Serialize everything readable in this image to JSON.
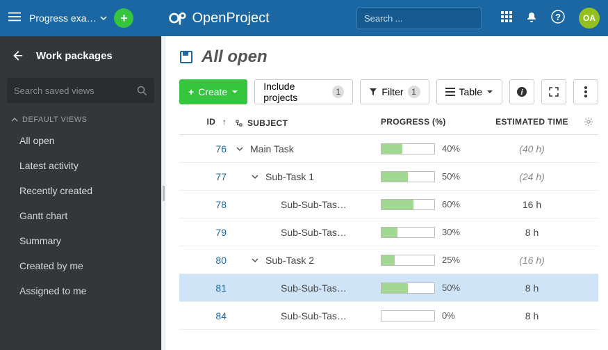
{
  "topbar": {
    "project_name": "Progress exa…",
    "search_placeholder": "Search ...",
    "avatar_initials": "OA",
    "brand": "OpenProject"
  },
  "sidebar": {
    "title": "Work packages",
    "search_placeholder": "Search saved views",
    "group_label": "DEFAULT VIEWS",
    "items": [
      {
        "label": "All open"
      },
      {
        "label": "Latest activity"
      },
      {
        "label": "Recently created"
      },
      {
        "label": "Gantt chart"
      },
      {
        "label": "Summary"
      },
      {
        "label": "Created by me"
      },
      {
        "label": "Assigned to me"
      }
    ]
  },
  "main": {
    "title": "All open",
    "create_label": "Create",
    "include_label": "Include projects",
    "include_count": "1",
    "filter_label": "Filter",
    "filter_count": "1",
    "table_label": "Table"
  },
  "columns": {
    "id": "ID",
    "subject": "SUBJECT",
    "progress": "PROGRESS (%)",
    "estimated": "ESTIMATED TIME"
  },
  "rows": [
    {
      "id": "76",
      "indent": 0,
      "expander": true,
      "subject": "Main Task",
      "progress": 40,
      "pct": "40%",
      "est": "(40 h)",
      "italic": true
    },
    {
      "id": "77",
      "indent": 1,
      "expander": true,
      "subject": "Sub-Task 1",
      "progress": 50,
      "pct": "50%",
      "est": "(24 h)",
      "italic": true
    },
    {
      "id": "78",
      "indent": 2,
      "expander": false,
      "subject": "Sub-Sub-Tas…",
      "progress": 60,
      "pct": "60%",
      "est": "16 h",
      "italic": false
    },
    {
      "id": "79",
      "indent": 2,
      "expander": false,
      "subject": "Sub-Sub-Tas…",
      "progress": 30,
      "pct": "30%",
      "est": "8 h",
      "italic": false
    },
    {
      "id": "80",
      "indent": 1,
      "expander": true,
      "subject": "Sub-Task 2",
      "progress": 25,
      "pct": "25%",
      "est": "(16 h)",
      "italic": true
    },
    {
      "id": "81",
      "indent": 2,
      "expander": false,
      "subject": "Sub-Sub-Tas…",
      "progress": 50,
      "pct": "50%",
      "est": "8 h",
      "italic": false,
      "selected": true
    },
    {
      "id": "84",
      "indent": 2,
      "expander": false,
      "subject": "Sub-Sub-Tas…",
      "progress": 0,
      "pct": "0%",
      "est": "8 h",
      "italic": false
    }
  ]
}
